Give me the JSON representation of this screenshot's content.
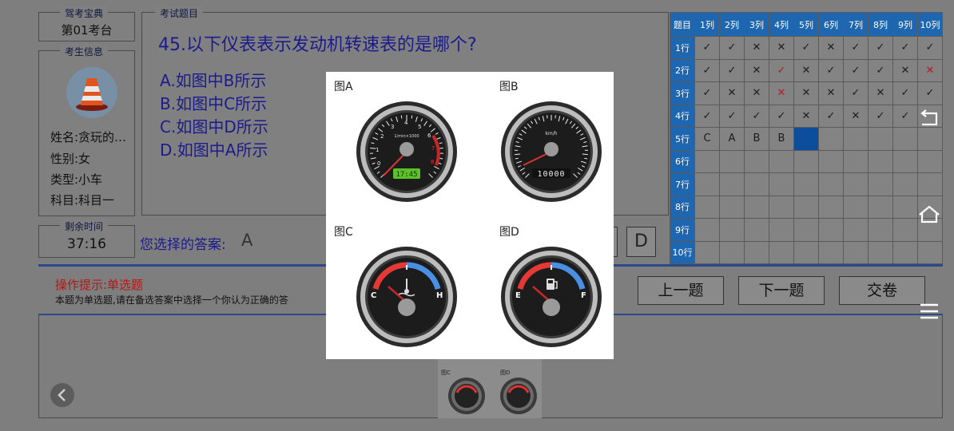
{
  "exam": {
    "legend": "驾考宝典",
    "seat": "第01考台"
  },
  "candidate": {
    "legend": "考生信息",
    "name": "姓名:贪玩的…",
    "gender": "性别:女",
    "type": "类型:小车",
    "subject": "科目:科目一"
  },
  "timer": {
    "legend": "剩余时间",
    "value": "37:16"
  },
  "question": {
    "legend": "考试题目",
    "text": "45.以下仪表表示发动机转速表的是哪个?",
    "options": [
      "A.如图中B所示",
      "B.如图中C所示",
      "C.如图中D所示",
      "D.如图中A所示"
    ]
  },
  "answer": {
    "label": "您选择的答案:",
    "value": "A",
    "d_button": "D"
  },
  "hint": {
    "title": "操作提示:单选题",
    "text": "本题为单选题,请在备选答案中选择一个你认为正确的答"
  },
  "buttons": {
    "prev": "上一题",
    "next": "下一题",
    "submit": "交卷"
  },
  "grid": {
    "header": [
      "题目",
      "1列",
      "2列",
      "3列",
      "4列",
      "5列",
      "6列",
      "7列",
      "8列",
      "9列",
      "10列"
    ],
    "rows": [
      {
        "label": "1行",
        "cells": [
          "✓",
          "✓",
          "✕",
          "✕",
          "✓",
          "✕",
          "✓",
          "✓",
          "✓",
          "✓"
        ]
      },
      {
        "label": "2行",
        "cells": [
          "✓",
          "✓",
          "✕",
          "✓",
          "✕",
          "✓",
          "✓",
          "✓",
          "✕",
          "✕"
        ]
      },
      {
        "label": "3行",
        "cells": [
          "✓",
          "✕",
          "✕",
          "✕",
          "✕",
          "✕",
          "✓",
          "✕",
          "✓",
          "✓"
        ]
      },
      {
        "label": "4行",
        "cells": [
          "✓",
          "✓",
          "✓",
          "✓",
          "✕",
          "✓",
          "✕",
          "✓",
          "✓",
          ""
        ]
      },
      {
        "label": "5行",
        "cells": [
          "C",
          "A",
          "B",
          "B",
          "",
          "",
          "",
          "",
          "",
          ""
        ]
      },
      {
        "label": "6行",
        "cells": [
          "",
          "",
          "",
          "",
          "",
          "",
          "",
          "",
          "",
          ""
        ]
      },
      {
        "label": "7行",
        "cells": [
          "",
          "",
          "",
          "",
          "",
          "",
          "",
          "",
          "",
          ""
        ]
      },
      {
        "label": "8行",
        "cells": [
          "",
          "",
          "",
          "",
          "",
          "",
          "",
          "",
          "",
          ""
        ]
      },
      {
        "label": "9行",
        "cells": [
          "",
          "",
          "",
          "",
          "",
          "",
          "",
          "",
          "",
          ""
        ]
      },
      {
        "label": "10行",
        "cells": [
          "",
          "",
          "",
          "",
          "",
          "",
          "",
          "",
          "",
          ""
        ]
      }
    ],
    "red_cells": [
      "1-3",
      "1-9",
      "2-3"
    ]
  },
  "popup": {
    "labels": [
      "图A",
      "图B",
      "图C",
      "图D"
    ],
    "gauge_a": {
      "unit": "1/min×1000",
      "digital": "17:45",
      "ticks": [
        "0",
        "1",
        "2",
        "3",
        "4",
        "5",
        "6",
        "7",
        "8"
      ]
    },
    "gauge_b": {
      "unit": "km/h",
      "odometer": "10000"
    },
    "gauge_c": {
      "low": "C",
      "high": "H"
    },
    "gauge_d": {
      "low": "E",
      "high": "F"
    }
  },
  "thumb": {
    "labels": [
      "图C",
      "图D"
    ]
  },
  "colors": {
    "panel_border": "#4a4a4a",
    "grid_header": "#1e66b0",
    "question_text": "#1b1b8c",
    "hint_title": "#b11818"
  }
}
